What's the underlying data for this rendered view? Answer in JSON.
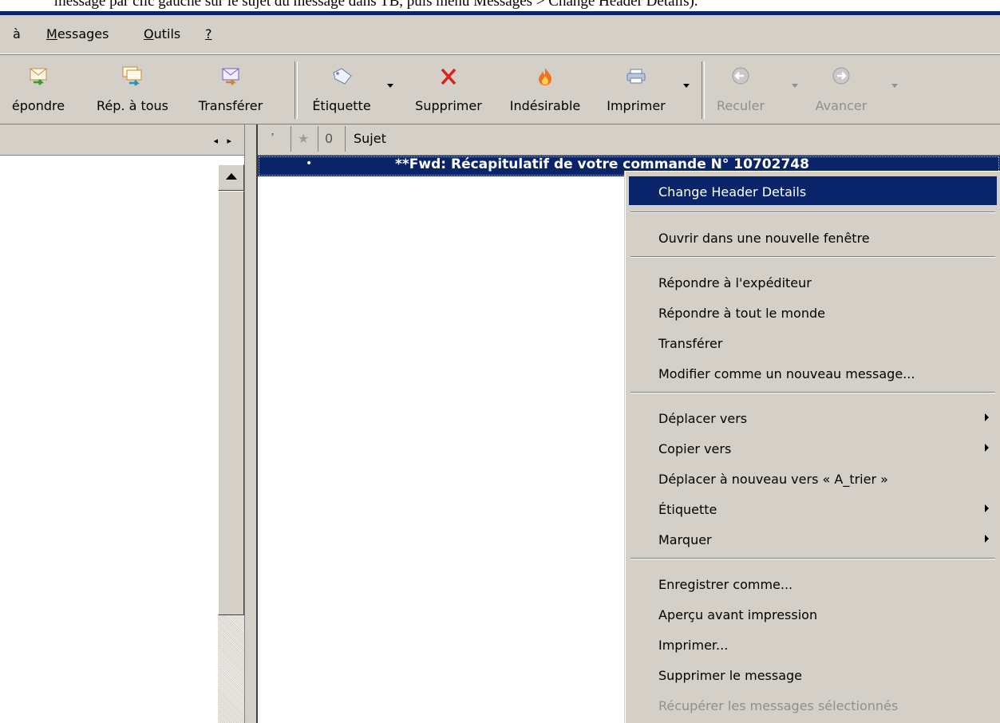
{
  "caption": "message par clic gauche sur le sujet du message dans TB, puis menu Messages > Change Header Details).",
  "menubar": {
    "items": [
      "à",
      "Messages",
      "Outils",
      "?"
    ]
  },
  "toolbar": {
    "reply": "épondre",
    "reply_all": "Rép. à tous",
    "forward": "Transférer",
    "tag": "Étiquette",
    "delete": "Supprimer",
    "junk": "Indésirable",
    "print": "Imprimer",
    "back": "Reculer",
    "forward_nav": "Avancer"
  },
  "columns": {
    "subject": "Sujet"
  },
  "message": {
    "subject": "**Fwd: Récapitulatif de votre commande N° 10702748"
  },
  "context_menu": {
    "items": [
      {
        "label": "Change Header Details"
      },
      {
        "label": "Ouvrir dans une nouvelle fenêtre"
      },
      {
        "label": "Répondre à l'expéditeur"
      },
      {
        "label": "Répondre à tout le monde"
      },
      {
        "label": "Transférer"
      },
      {
        "label": "Modifier comme un nouveau message..."
      },
      {
        "label": "Déplacer vers"
      },
      {
        "label": "Copier vers"
      },
      {
        "label": "Déplacer à nouveau vers « A_trier »"
      },
      {
        "label": "Étiquette"
      },
      {
        "label": "Marquer"
      },
      {
        "label": "Enregistrer comme..."
      },
      {
        "label": "Aperçu avant impression"
      },
      {
        "label": "Imprimer..."
      },
      {
        "label": "Supprimer le message"
      },
      {
        "label": "Récupérer les messages sélectionnés"
      }
    ]
  },
  "colors": {
    "selection": "#0a246a",
    "chrome": "#d4d0c8",
    "disabled_text": "#8f8f8f"
  }
}
